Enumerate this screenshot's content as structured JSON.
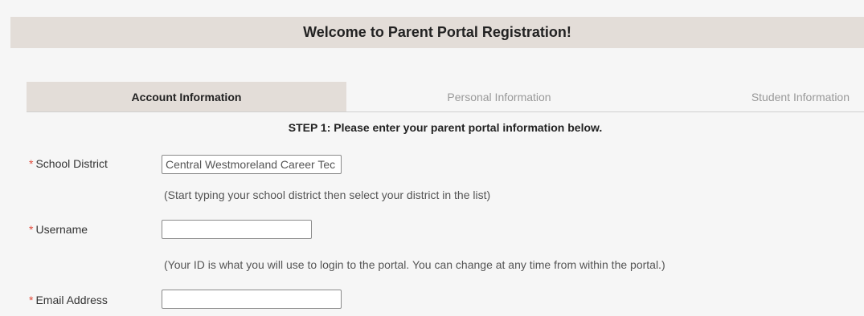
{
  "page": {
    "title": "Welcome to Parent Portal Registration!"
  },
  "tabs": [
    {
      "label": "Account Information",
      "active": true
    },
    {
      "label": "Personal Information",
      "active": false
    },
    {
      "label": "Student Information",
      "active": false
    }
  ],
  "step_text": "STEP 1: Please enter your parent portal information below.",
  "form": {
    "required_marker": "*",
    "school_district": {
      "label": "School District",
      "value": "Central Westmoreland Career Tec",
      "hint": "(Start typing your school district then select your district in the list)"
    },
    "username": {
      "label": "Username",
      "value": "",
      "hint": "(Your ID is what you will use to login to the portal. You can change at any time from within the portal.)"
    },
    "email": {
      "label": "Email Address",
      "value": ""
    }
  },
  "colors": {
    "header_bg": "#e3ddd8",
    "required": "#e04a3a",
    "page_bg": "#f6f6f6"
  }
}
